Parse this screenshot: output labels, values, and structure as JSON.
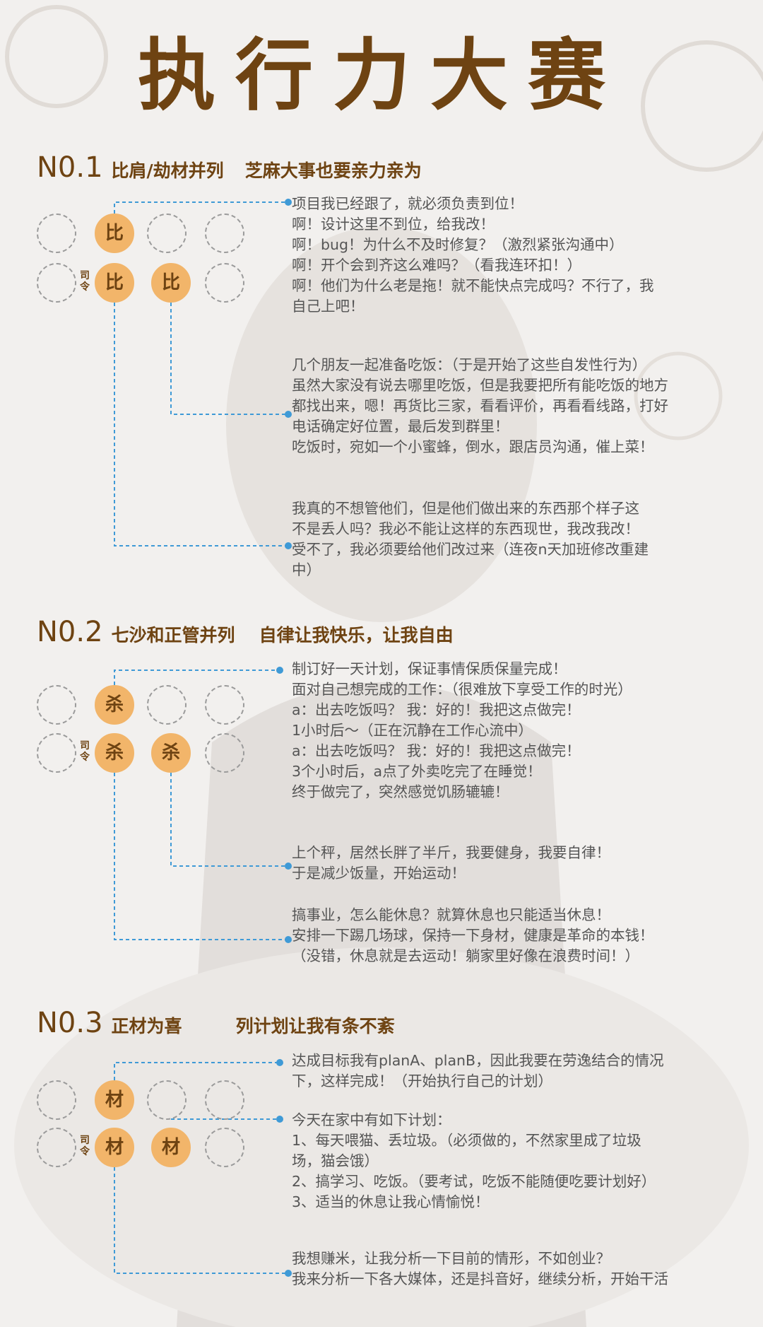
{
  "title": "执行力大赛",
  "colors": {
    "brown": "#6e4312",
    "orange": "#f2b56a",
    "connector": "#3f9ad6",
    "text": "#555555"
  },
  "sections": [
    {
      "no": "N0.1",
      "heading_a": "比肩/劫材并列",
      "heading_b": "芝麻大事也要亲力亲为",
      "char": "比",
      "siling": [
        "司",
        "令"
      ],
      "blocks": [
        [
          "项目我已经跟了，就必须负责到位！",
          "啊！设计这里不到位，给我改！",
          "啊！bug！为什么不及时修复？（激烈紧张沟通中）",
          "啊！开个会到齐这么难吗？（看我连环扣！）",
          "啊！他们为什么老是拖！就不能快点完成吗？不行了，我",
          "自己上吧！"
        ],
        [
          "几个朋友一起准备吃饭：（于是开始了这些自发性行为）",
          "虽然大家没有说去哪里吃饭，但是我要把所有能吃饭的地方",
          "都找出来，嗯！再货比三家，看看评价，再看看线路，打好",
          "电话确定好位置，最后发到群里！",
          "吃饭时，宛如一个小蜜蜂，倒水，跟店员沟通，催上菜！"
        ],
        [
          "我真的不想管他们，但是他们做出来的东西那个样子这",
          "不是丢人吗？我必不能让这样的东西现世，我改我改！",
          "受不了，我必须要给他们改过来（连夜n天加班修改重建",
          "中）"
        ]
      ]
    },
    {
      "no": "N0.2",
      "heading_a": "七沙和正管并列",
      "heading_b": "自律让我快乐，让我自由",
      "char": "杀",
      "siling": [
        "司",
        "令"
      ],
      "blocks": [
        [
          "制订好一天计划，保证事情保质保量完成！",
          "面对自己想完成的工作：（很难放下享受工作的时光）",
          "a：出去吃饭吗？ 我：好的！我把这点做完！",
          "1小时后～（正在沉静在工作心流中）",
          "a：出去吃饭吗？ 我：好的！我把这点做完！",
          "3个小时后，a点了外卖吃完了在睡觉！",
          "终于做完了，突然感觉饥肠辘辘！"
        ],
        [
          "上个秤，居然长胖了半斤，我要健身，我要自律！",
          "于是减少饭量，开始运动！"
        ],
        [
          "搞事业，怎么能休息？就算休息也只能适当休息！",
          "安排一下踢几场球，保持一下身材，健康是革命的本钱！",
          "（没错，休息就是去运动！躺家里好像在浪费时间！）"
        ]
      ]
    },
    {
      "no": "N0.3",
      "heading_a": "正材为喜",
      "heading_b": "列计划让我有条不紊",
      "char": "材",
      "siling": [
        "司",
        "令"
      ],
      "blocks": [
        [
          "达成目标我有planA、planB，因此我要在劳逸结合的情况",
          "下，这样完成！（开始执行自己的计划）"
        ],
        [
          "今天在家中有如下计划：",
          "1、每天喂猫、丢垃圾。（必须做的，不然家里成了垃圾",
          "场，猫会饿）",
          "2、搞学习、吃饭。（要考试，吃饭不能随便吃要计划好）",
          "3、适当的休息让我心情愉悦！"
        ],
        [
          "我想赚米，让我分析一下目前的情形，不如创业？",
          "我来分析一下各大媒体，还是抖音好，继续分析，开始干活"
        ]
      ]
    }
  ]
}
